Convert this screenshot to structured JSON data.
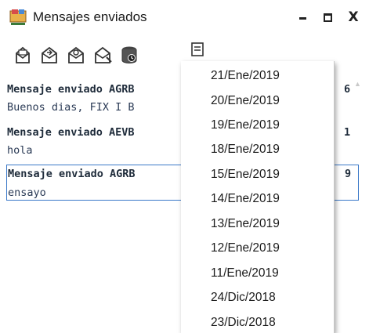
{
  "window": {
    "title": "Mensajes enviados",
    "close_label": "X",
    "accent": "#3a78c8"
  },
  "toolbar": {
    "buttons": [
      {
        "icon": "print-message-icon"
      },
      {
        "icon": "mail-reply-icon"
      },
      {
        "icon": "mail-forward-icon"
      },
      {
        "icon": "mail-open-icon"
      },
      {
        "icon": "database-icon"
      },
      {
        "icon": "date-filter-icon"
      }
    ]
  },
  "messages": [
    {
      "head": "Mensaje enviado AGRB",
      "tail": "6",
      "body": "Buenos dias, FIX I B",
      "selected": false
    },
    {
      "head": "Mensaje enviado AEVB",
      "tail": "1",
      "body": "hola",
      "selected": false
    },
    {
      "head": "Mensaje enviado AGRB",
      "tail": "9",
      "body": "ensayo",
      "selected": true
    }
  ],
  "date_menu": {
    "items": [
      "21/Ene/2019",
      "20/Ene/2019",
      "19/Ene/2019",
      "18/Ene/2019",
      "15/Ene/2019",
      "14/Ene/2019",
      "13/Ene/2019",
      "12/Ene/2019",
      "11/Ene/2019",
      "24/Dic/2018",
      "23/Dic/2018"
    ]
  }
}
